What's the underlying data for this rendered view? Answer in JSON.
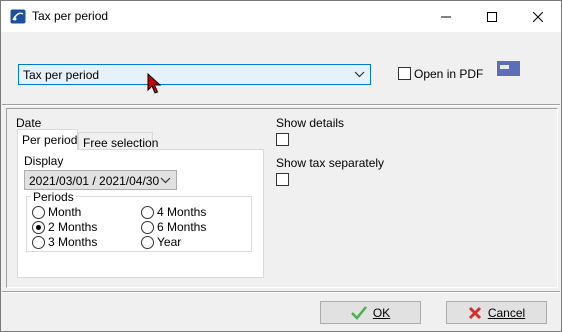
{
  "window": {
    "title": "Tax per period",
    "controls": [
      "minimize",
      "maximize",
      "close"
    ]
  },
  "report": {
    "selected": "Tax per period",
    "open_in_pdf_label": "Open in PDF",
    "open_in_pdf_checked": false,
    "email_icon": "email-icon"
  },
  "date": {
    "label": "Date",
    "tabs": [
      {
        "label": "Per period",
        "active": true
      },
      {
        "label": "Free selection",
        "active": false
      }
    ],
    "display_label": "Display",
    "display_value": "2021/03/01 / 2021/04/30",
    "periods_label": "Periods",
    "periods": [
      {
        "label": "Month",
        "selected": false
      },
      {
        "label": "2 Months",
        "selected": true
      },
      {
        "label": "3 Months",
        "selected": false
      },
      {
        "label": "4 Months",
        "selected": false
      },
      {
        "label": "6 Months",
        "selected": false
      },
      {
        "label": "Year",
        "selected": false
      }
    ]
  },
  "options": {
    "show_details_label": "Show details",
    "show_details_checked": false,
    "show_tax_label": "Show tax separately",
    "show_tax_checked": false
  },
  "buttons": {
    "ok_label": "OK",
    "cancel_label": "Cancel"
  },
  "colors": {
    "accent": "#0078d7",
    "select_bg": "#e5f1fb",
    "ok_icon": "#4caf50",
    "cancel_icon": "#d32f2f"
  }
}
